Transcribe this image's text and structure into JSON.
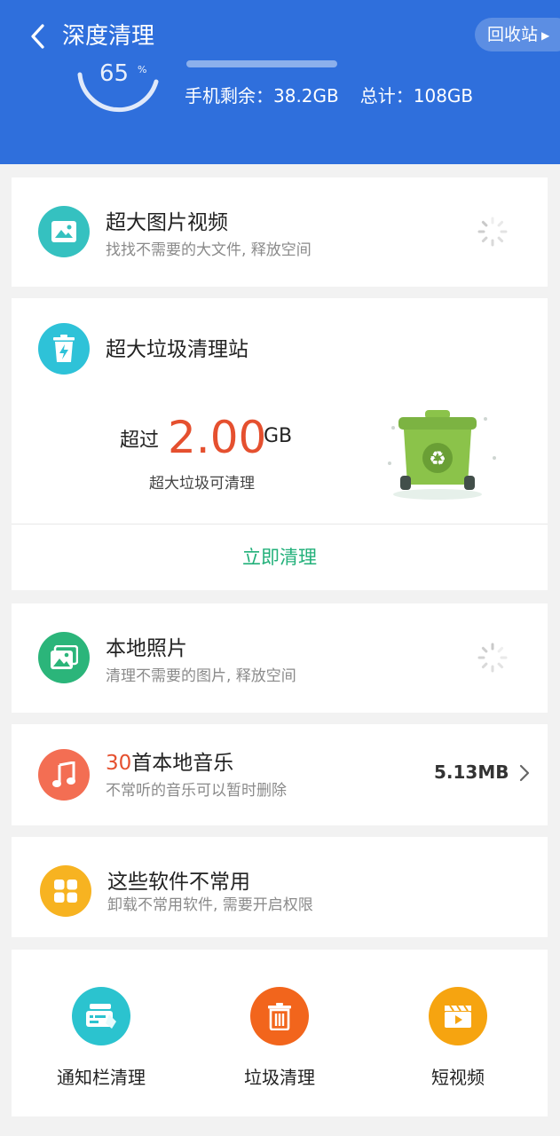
{
  "header": {
    "title": "深度清理",
    "recycle_label": "回收站",
    "ring_value": "65",
    "ring_unit": "%",
    "storage_left_label": "手机剩余：38.2GB",
    "storage_total_label": "总计：108GB"
  },
  "colors": {
    "header_bg": "#2f6fdc",
    "accent_red": "#e5502f",
    "accent_green": "#22b07a"
  },
  "cards": {
    "big_media": {
      "title": "超大图片视频",
      "subtitle": "找找不需要的大文件, 释放空间",
      "icon": "image-icon"
    },
    "junk_station": {
      "title": "超大垃圾清理站",
      "prefix": "超过",
      "amount": "2.00",
      "unit": "GB",
      "subtitle": "超大垃圾可清理",
      "button": "立即清理",
      "icon": "trash-bolt-icon"
    },
    "local_photos": {
      "title": "本地照片",
      "subtitle": "清理不需要的图片, 释放空间",
      "icon": "photos-icon"
    },
    "local_music": {
      "count": "30",
      "title_suffix": "首本地音乐",
      "subtitle": "不常听的音乐可以暂时删除",
      "size": "5.13MB",
      "icon": "music-note-icon"
    },
    "unused_apps": {
      "title": "这些软件不常用",
      "subtitle": "卸载不常用软件, 需要开启权限",
      "icon": "apps-grid-icon"
    }
  },
  "tools": [
    {
      "label": "通知栏清理",
      "icon": "notification-clean-icon",
      "color": "#2bc3cf"
    },
    {
      "label": "垃圾清理",
      "icon": "trash-icon",
      "color": "#f2651c"
    },
    {
      "label": "短视频",
      "icon": "video-icon",
      "color": "#f6a410"
    }
  ]
}
